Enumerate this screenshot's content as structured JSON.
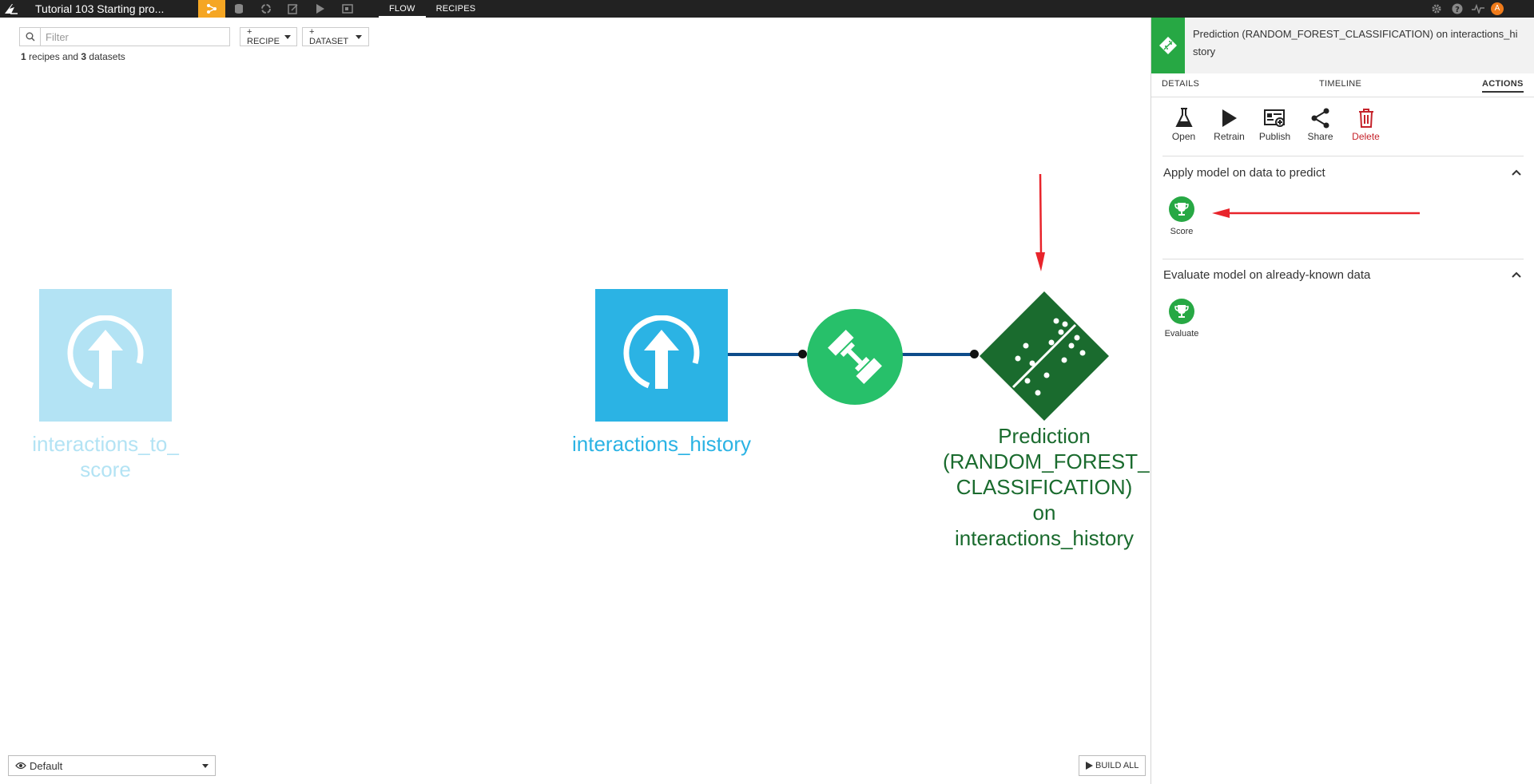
{
  "topbar": {
    "project_title": "Tutorial 103 Starting pro...",
    "tabs": [
      "FLOW",
      "RECIPES"
    ],
    "avatar_initial": "A"
  },
  "filter": {
    "placeholder": "Filter",
    "add_recipe_label": "+ RECIPE",
    "add_dataset_label": "+ DATASET",
    "summary_count_recipes": "1",
    "summary_text_recipes": " recipes and ",
    "summary_count_datasets": "3",
    "summary_text_datasets": " datasets"
  },
  "flow": {
    "dataset_to_score": {
      "label": "interactions_to_\nscore",
      "color": "#b3e3f4"
    },
    "dataset_history": {
      "label": "interactions_history",
      "color": "#2bb3e4"
    },
    "recipe_train": {
      "icon": "dumbbell-icon",
      "color": "#27c06a"
    },
    "model": {
      "label": "Prediction\n(RANDOM_FOREST_\nCLASSIFICATION) on\ninteractions_history",
      "color": "#1a6b2e"
    }
  },
  "bottom": {
    "view_select": "Default",
    "build_all_label": "BUILD ALL"
  },
  "panel": {
    "title": "Prediction (RANDOM_FOREST_CLASSIFICATION) on interactions_history",
    "tabs": [
      "DETAILS",
      "TIMELINE",
      "ACTIONS"
    ],
    "active_tab": "ACTIONS",
    "actions": [
      {
        "label": "Open",
        "icon": "flask-icon"
      },
      {
        "label": "Retrain",
        "icon": "play-icon"
      },
      {
        "label": "Publish",
        "icon": "publish-icon"
      },
      {
        "label": "Share",
        "icon": "share-icon"
      },
      {
        "label": "Delete",
        "icon": "trash-icon"
      }
    ],
    "sections": [
      {
        "title": "Apply model on data to predict",
        "items": [
          {
            "label": "Score",
            "icon": "trophy-icon"
          }
        ]
      },
      {
        "title": "Evaluate model on already-known data",
        "items": [
          {
            "label": "Evaluate",
            "icon": "trophy-icon"
          }
        ]
      }
    ]
  },
  "colors": {
    "accent_orange": "#f5a623",
    "annotation_red": "#e8242b",
    "link_blue": "#0e4c8a",
    "score_green": "#27a844"
  }
}
